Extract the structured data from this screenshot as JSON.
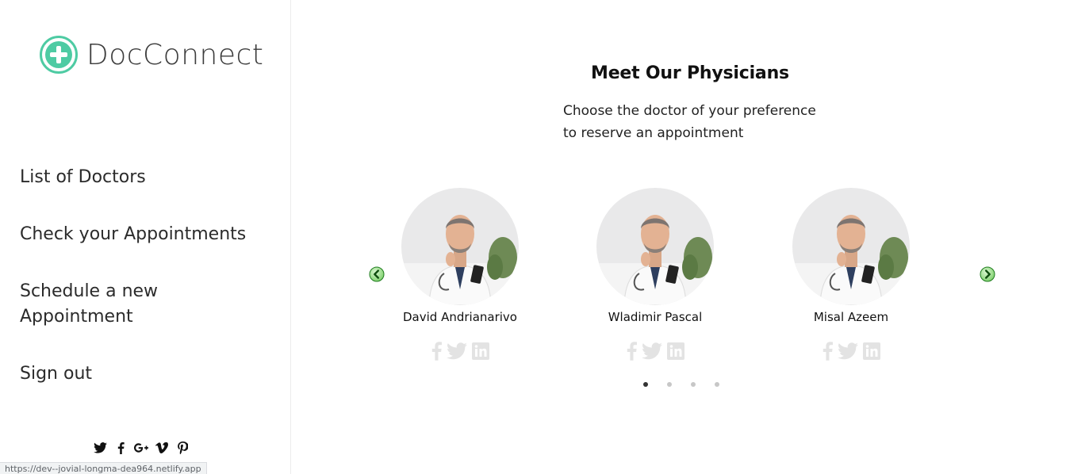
{
  "brand": {
    "name": "DocConnect",
    "accent": "#4ecba3"
  },
  "sidebar": {
    "nav": [
      {
        "label": "List of Doctors"
      },
      {
        "label": "Check your Appointments"
      },
      {
        "label": "Schedule a new Appointment"
      },
      {
        "label": "Sign out"
      }
    ],
    "social_icons": [
      "twitter-icon",
      "facebook-icon",
      "google-plus-icon",
      "vimeo-icon",
      "pinterest-icon"
    ]
  },
  "status_bar": {
    "url": "https://dev--jovial-longma-dea964.netlify.app"
  },
  "main": {
    "title": "Meet Our Physicians",
    "subtitle": "Choose the doctor of your preference to reserve an appointment",
    "doctors": [
      {
        "name": "David Andrianarivo"
      },
      {
        "name": "Wladimir Pascal"
      },
      {
        "name": "Misal Azeem"
      }
    ],
    "card_social_icons": [
      "facebook-icon",
      "twitter-icon",
      "linkedin-icon"
    ],
    "carousel": {
      "page_count": 4,
      "active_page": 1
    },
    "colors": {
      "arrow_green": "#2aa52a",
      "icon_gray": "#e3e3e3"
    }
  }
}
